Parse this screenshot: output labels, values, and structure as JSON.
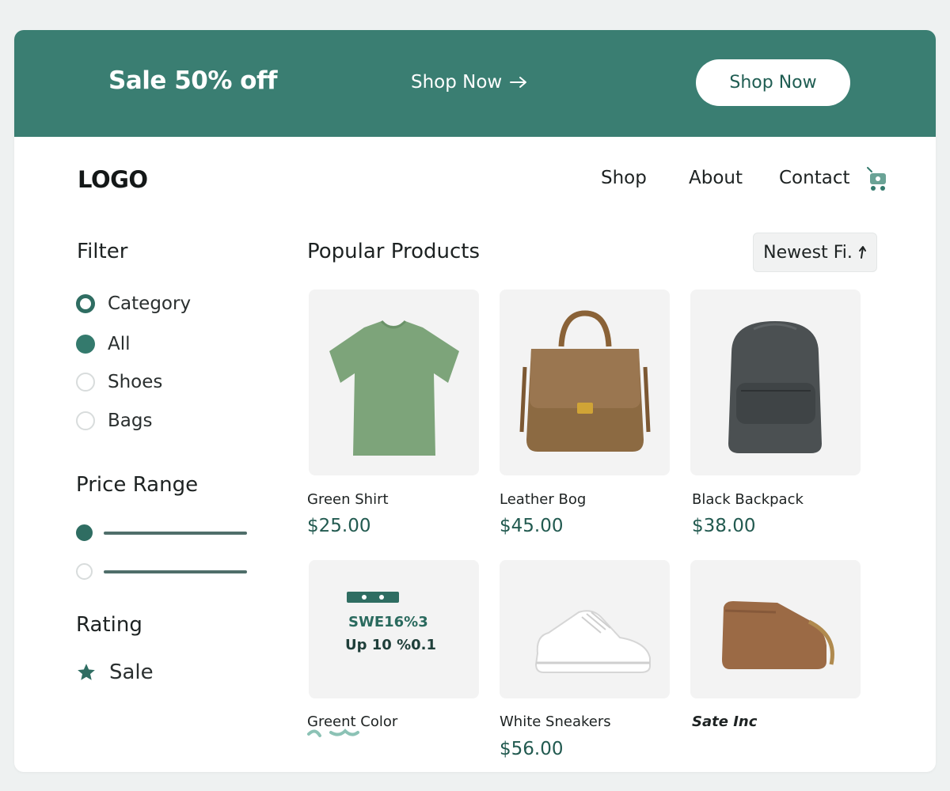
{
  "colors": {
    "accent": "#3a7e72",
    "price": "#225a50",
    "background": "#eef1f1"
  },
  "banner": {
    "title": "Sale 50% off",
    "link_label": "Shop Now",
    "link_icon": "arrow-right-icon",
    "button_label": "Shop Now"
  },
  "header": {
    "logo": "LOGO",
    "nav": [
      "Shop",
      "About",
      "Contact"
    ],
    "cart_icon": "cart-icon"
  },
  "sidebar": {
    "filter_title": "Filter",
    "options": [
      {
        "label": "Category",
        "state": "ring"
      },
      {
        "label": "All",
        "state": "checked"
      },
      {
        "label": "Shoes",
        "state": "unchecked"
      },
      {
        "label": "Bags",
        "state": "unchecked"
      }
    ],
    "price_title": "Price Range",
    "rating_title": "Rating",
    "rating_item": "Sale",
    "rating_icon": "star-icon"
  },
  "main": {
    "title": "Popular Products",
    "sort_label": "Newest Fi.",
    "sort_icon": "arrow-up-icon",
    "products": [
      {
        "name": "Green Shirt",
        "price": "$25.00",
        "image": "green-shirt-image"
      },
      {
        "name": "Leather Bog",
        "price": "$45.00",
        "image": "leather-bag-image"
      },
      {
        "name": "Black Backpack",
        "price": "$38.00",
        "image": "black-backpack-image"
      },
      {
        "name": "Greent Color",
        "price": "",
        "image": "promo-graphic-image",
        "promo_line1": "SWE16%3",
        "promo_line2": "Up 10 %0.1"
      },
      {
        "name": "White Sneakers",
        "price": "$56.00",
        "image": "white-sneakers-image"
      },
      {
        "name": "Sate Inc",
        "price": "",
        "image": "brown-pouch-image"
      }
    ]
  }
}
